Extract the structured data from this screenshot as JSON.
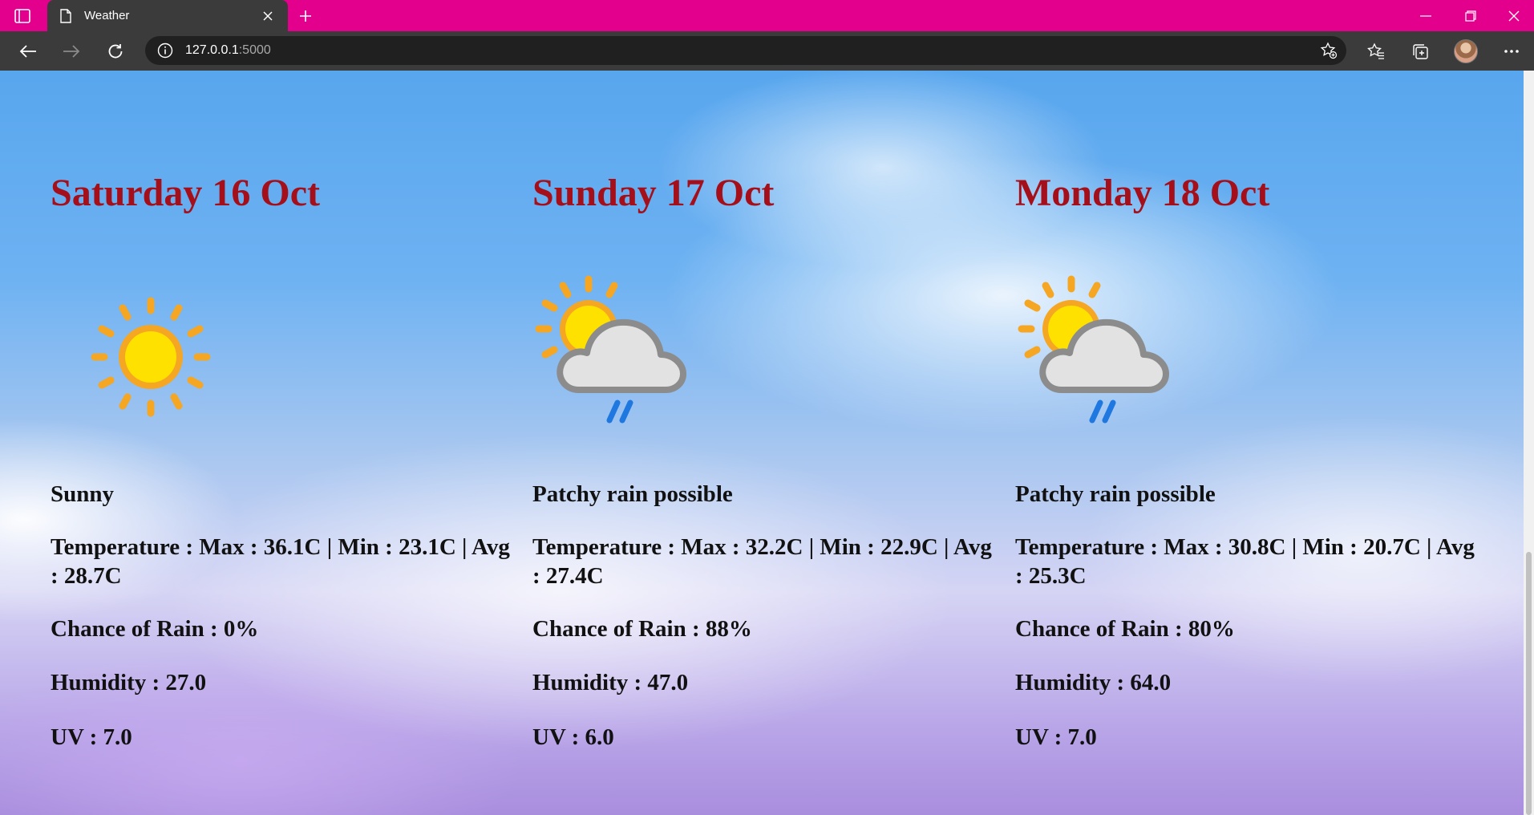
{
  "browser": {
    "tab_title": "Weather",
    "url_host": "127.0.0.1",
    "url_port": ":5000"
  },
  "days": [
    {
      "title": "Saturday 16 Oct",
      "icon": "sun-icon",
      "condition": "Sunny",
      "temperature": "Temperature : Max : 36.1C | Min : 23.1C | Avg : 28.7C",
      "rain": "Chance of Rain : 0%",
      "humidity": "Humidity : 27.0",
      "uv": "UV : 7.0"
    },
    {
      "title": "Sunday 17 Oct",
      "icon": "patchy-rain-icon",
      "condition": "Patchy rain possible",
      "temperature": "Temperature : Max : 32.2C | Min : 22.9C | Avg : 27.4C",
      "rain": "Chance of Rain : 88%",
      "humidity": "Humidity : 47.0",
      "uv": "UV : 6.0"
    },
    {
      "title": "Monday 18 Oct",
      "icon": "patchy-rain-icon",
      "condition": "Patchy rain possible",
      "temperature": "Temperature : Max : 30.8C | Min : 20.7C | Avg : 25.3C",
      "rain": "Chance of Rain : 80%",
      "humidity": "Humidity : 64.0",
      "uv": "UV : 7.0"
    }
  ],
  "colors": {
    "titlebar": "#e3008c",
    "toolbar": "#3b3b3b",
    "day_title": "#a50f1a",
    "text": "#111111"
  }
}
